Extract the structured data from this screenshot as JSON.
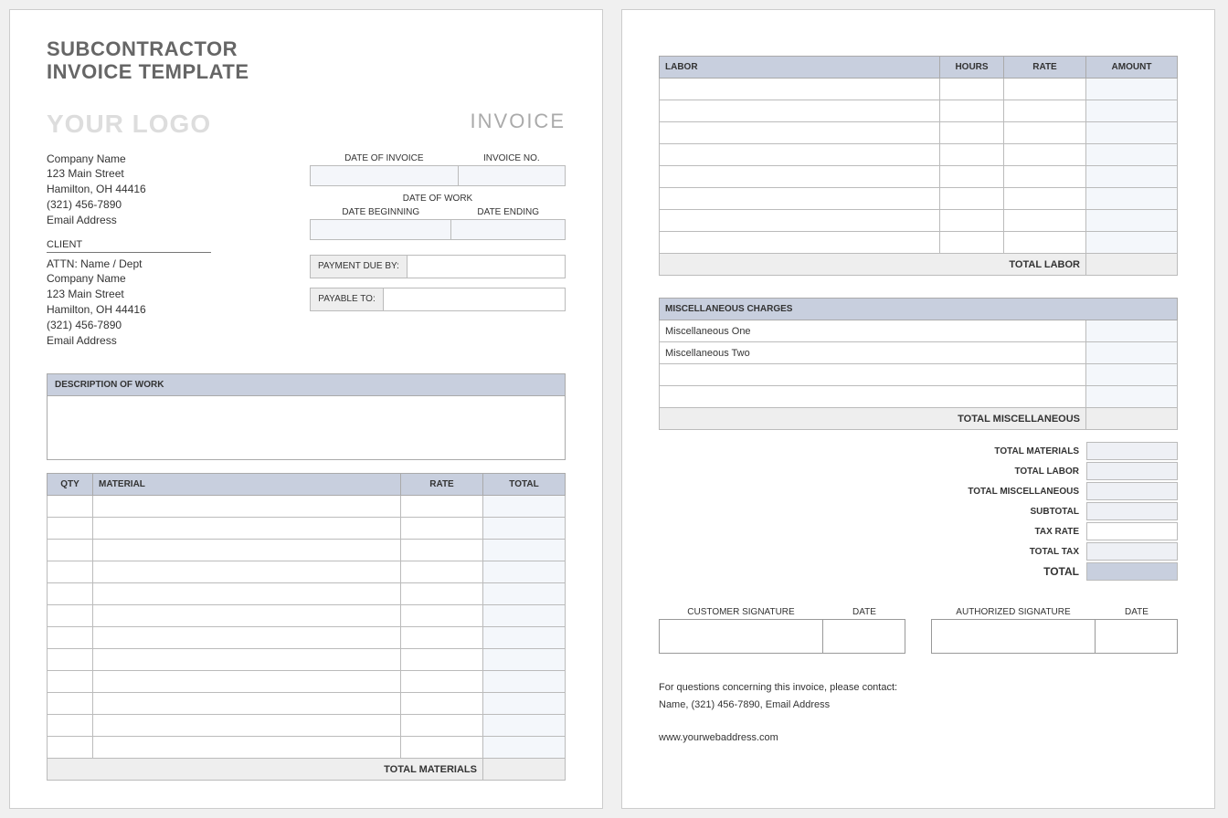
{
  "title_line1": "SUBCONTRACTOR",
  "title_line2": "INVOICE TEMPLATE",
  "logo_text": "YOUR LOGO",
  "invoice_word": "INVOICE",
  "company": {
    "name": "Company Name",
    "street": "123 Main Street",
    "citystate": "Hamilton, OH  44416",
    "phone": "(321) 456-7890",
    "email": "Email Address"
  },
  "client_label": "CLIENT",
  "client": {
    "attn": "ATTN: Name / Dept",
    "name": "Company Name",
    "street": "123 Main Street",
    "citystate": "Hamilton, OH  44416",
    "phone": "(321) 456-7890",
    "email": "Email Address"
  },
  "labels": {
    "date_of_invoice": "DATE OF INVOICE",
    "invoice_no": "INVOICE NO.",
    "date_of_work": "DATE OF WORK",
    "date_beginning": "DATE BEGINNING",
    "date_ending": "DATE ENDING",
    "payment_due": "PAYMENT DUE BY:",
    "payable_to": "PAYABLE TO:",
    "description_of_work": "DESCRIPTION OF WORK"
  },
  "materials": {
    "headers": {
      "qty": "QTY",
      "material": "MATERIAL",
      "rate": "RATE",
      "total": "TOTAL"
    },
    "rows": 12,
    "total_label": "TOTAL MATERIALS"
  },
  "labor": {
    "headers": {
      "labor": "LABOR",
      "hours": "HOURS",
      "rate": "RATE",
      "amount": "AMOUNT"
    },
    "rows": 8,
    "total_label": "TOTAL LABOR"
  },
  "misc": {
    "header": "MISCELLANEOUS CHARGES",
    "row1": "Miscellaneous One",
    "row2": "Miscellaneous Two",
    "total_label": "TOTAL MISCELLANEOUS"
  },
  "summary": {
    "total_materials": "TOTAL MATERIALS",
    "total_labor": "TOTAL LABOR",
    "total_misc": "TOTAL MISCELLANEOUS",
    "subtotal": "SUBTOTAL",
    "tax_rate": "TAX RATE",
    "total_tax": "TOTAL TAX",
    "total": "TOTAL"
  },
  "signatures": {
    "customer": "CUSTOMER SIGNATURE",
    "authorized": "AUTHORIZED SIGNATURE",
    "date": "DATE"
  },
  "footer": {
    "line1": "For questions concerning this invoice, please contact:",
    "line2": "Name, (321) 456-7890, Email Address",
    "web": "www.yourwebaddress.com"
  }
}
